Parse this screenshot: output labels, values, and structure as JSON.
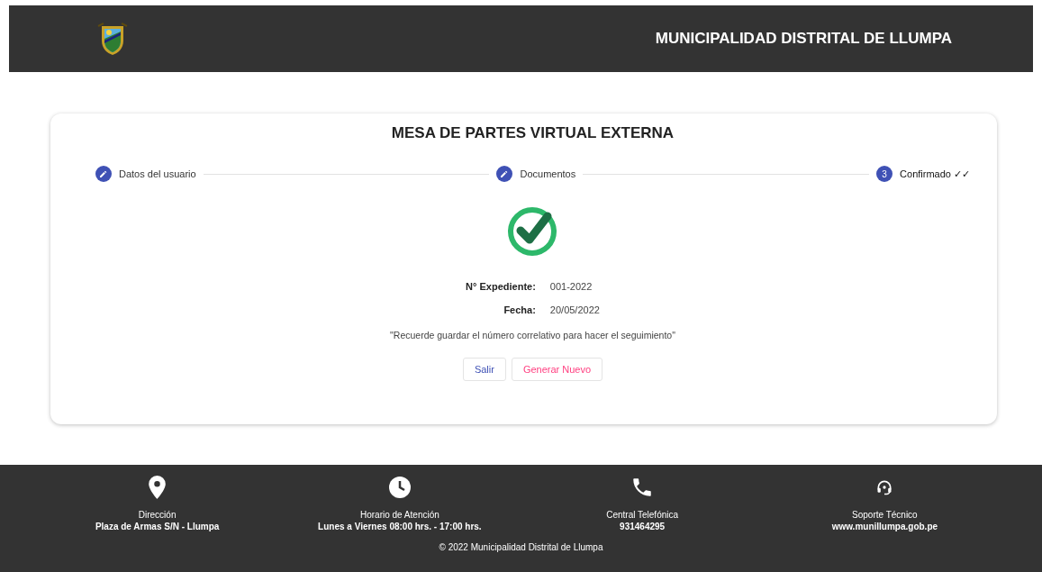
{
  "header": {
    "title": "MUNICIPALIDAD DISTRITAL DE LLUMPA"
  },
  "card": {
    "title": "MESA DE PARTES VIRTUAL EXTERNA",
    "steps": [
      {
        "label": "Datos del usuario",
        "kind": "done"
      },
      {
        "label": "Documentos",
        "kind": "done"
      },
      {
        "label": "Confirmado ✓✓",
        "kind": "current",
        "number": "3"
      }
    ],
    "fields": [
      {
        "label": "N° Expediente:",
        "value": "001-2022"
      },
      {
        "label": "Fecha:",
        "value": "20/05/2022"
      }
    ],
    "note": "\"Recuerde guardar el número correlativo para hacer el seguimiento\"",
    "buttons": [
      {
        "label": "Salir",
        "kind": "primary"
      },
      {
        "label": "Generar Nuevo",
        "kind": "accent"
      }
    ]
  },
  "footer": {
    "items": [
      {
        "kind": "location",
        "label": "Dirección",
        "value": "Plaza de Armas S/N - Llumpa"
      },
      {
        "kind": "clock",
        "label": "Horario de Atención",
        "value": "Lunes a Viernes 08:00 hrs. - 17:00 hrs."
      },
      {
        "kind": "phone",
        "label": "Central Telefónica",
        "value": "931464295"
      },
      {
        "kind": "support",
        "label": "Soporte Técnico",
        "value": "www.munillumpa.gob.pe"
      }
    ],
    "copyright": "© 2022 Municipalidad Distrital de Llumpa"
  }
}
